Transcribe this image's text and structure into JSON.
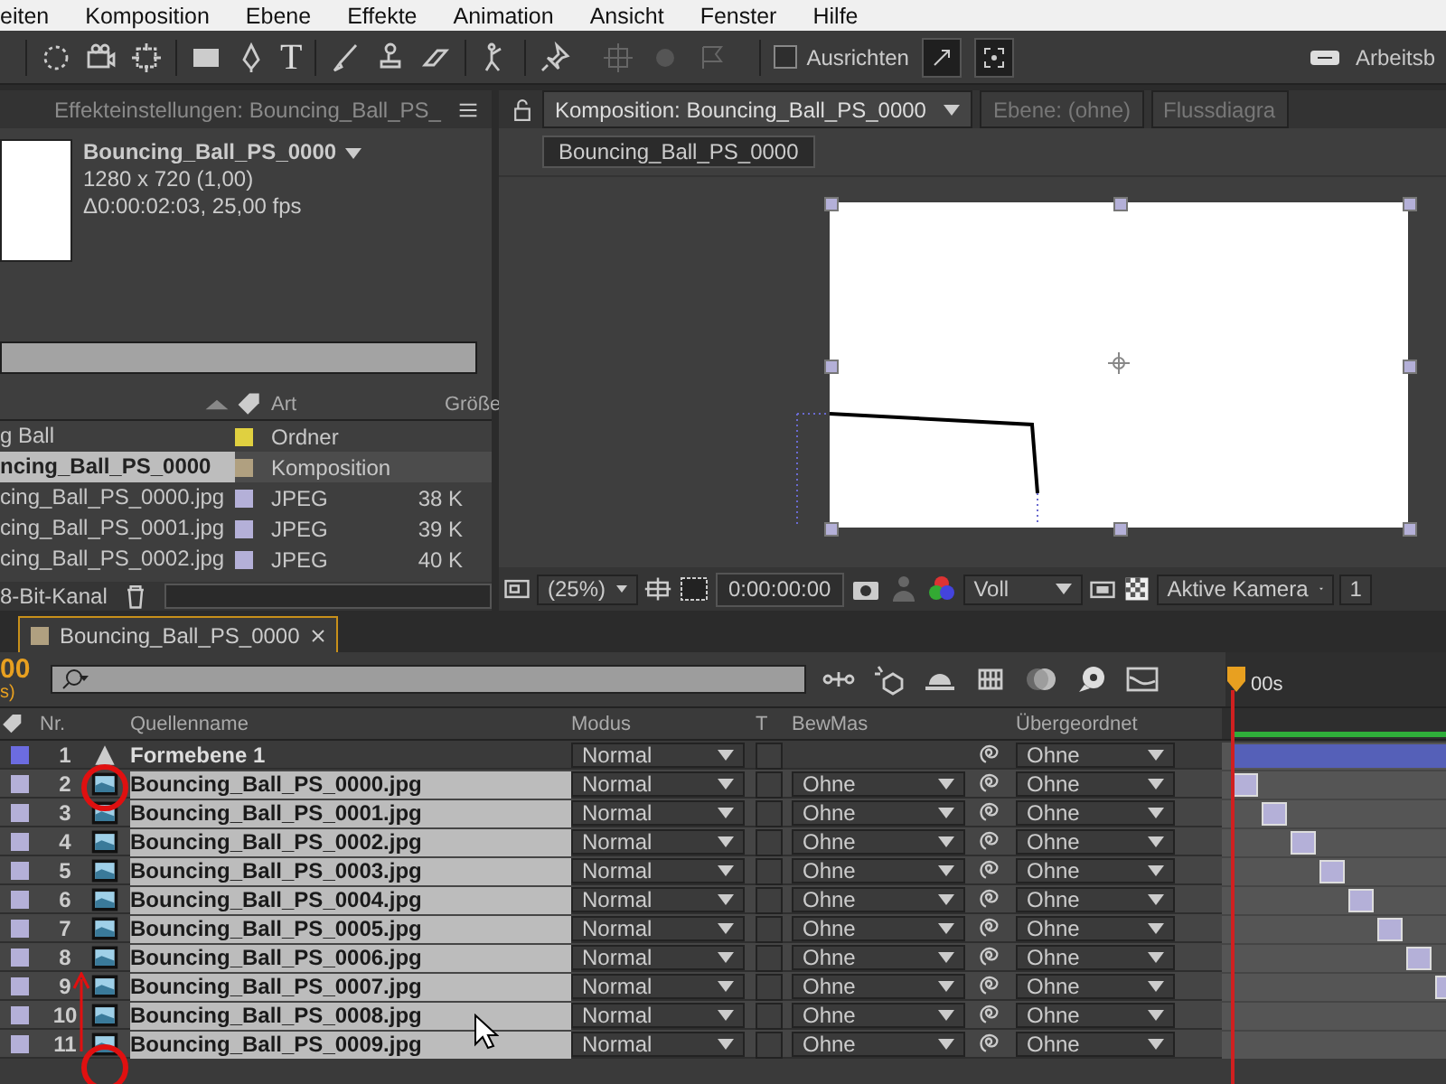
{
  "menu": [
    {
      "label": "eiten"
    },
    {
      "label": "Komposition"
    },
    {
      "label": "Ebene"
    },
    {
      "label": "Effekte"
    },
    {
      "label": "Animation"
    },
    {
      "label": "Ansicht"
    },
    {
      "label": "Fenster"
    },
    {
      "label": "Hilfe"
    }
  ],
  "toolbar": {
    "text_tool_glyph": "T",
    "align": {
      "label": "Ausrichten",
      "checked": false
    },
    "workspace_label": "Arbeitsb"
  },
  "project_panel": {
    "tab_title": "Effekteinstellungen: Bouncing_Ball_PS_",
    "comp_name": "Bouncing_Ball_PS_0000",
    "resolution": "1280 x 720 (1,00)",
    "duration": "Δ0:00:02:03, 25,00 fps",
    "columns": [
      "Art",
      "Größe"
    ],
    "items": [
      {
        "name": "g Ball",
        "type": "Ordner",
        "color": "#e0d040",
        "selected": false
      },
      {
        "name": "ncing_Ball_PS_0000",
        "type": "Komposition",
        "color": "#b0a080",
        "selected": true
      },
      {
        "name": "cing_Ball_PS_0000.jpg",
        "type": "JPEG",
        "size": "38 K",
        "color": "#b4b0d8",
        "selected": false
      },
      {
        "name": "cing_Ball_PS_0001.jpg",
        "type": "JPEG",
        "size": "39 K",
        "color": "#b4b0d8",
        "selected": false
      },
      {
        "name": "cing_Ball_PS_0002.jpg",
        "type": "JPEG",
        "size": "40 K",
        "color": "#b4b0d8",
        "selected": false
      }
    ],
    "footer": "8-Bit-Kanal"
  },
  "viewer": {
    "tabs": [
      {
        "label": "Komposition: Bouncing_Ball_PS_0000",
        "selected": true
      },
      {
        "label": "Ebene: (ohne)",
        "selected": false
      },
      {
        "label": "Flussdiagra",
        "selected": false
      }
    ],
    "breadcrumb": "Bouncing_Ball_PS_0000",
    "zoom": "(25%)",
    "timecode": "0:00:00:00",
    "resolution": "Voll",
    "camera": "Aktive Kamera",
    "extra": "1"
  },
  "timeline": {
    "tab_title": "Bouncing_Ball_PS_0000",
    "current_time": "00",
    "time_unit": "s)",
    "ruler_label": "00s",
    "columns": {
      "number": "Nr.",
      "name": "Quellenname",
      "mode": "Modus",
      "transparency": "T",
      "track_matte": "BewMas",
      "parent": "Übergeordnet"
    },
    "layers": [
      {
        "number": "1",
        "kind": "shape",
        "name": "Formebene 1",
        "mode": "Normal",
        "parent": "Ohne",
        "color": "#6c6ce0",
        "selected": false
      },
      {
        "number": "2",
        "kind": "footage",
        "name": "Bouncing_Ball_PS_0000.jpg",
        "mode": "Normal",
        "track_matte": "Ohne",
        "parent": "Ohne",
        "color": "#b4b0d8",
        "selected": true
      },
      {
        "number": "3",
        "kind": "footage",
        "name": "Bouncing_Ball_PS_0001.jpg",
        "mode": "Normal",
        "track_matte": "Ohne",
        "parent": "Ohne",
        "color": "#b4b0d8",
        "selected": true
      },
      {
        "number": "4",
        "kind": "footage",
        "name": "Bouncing_Ball_PS_0002.jpg",
        "mode": "Normal",
        "track_matte": "Ohne",
        "parent": "Ohne",
        "color": "#b4b0d8",
        "selected": true
      },
      {
        "number": "5",
        "kind": "footage",
        "name": "Bouncing_Ball_PS_0003.jpg",
        "mode": "Normal",
        "track_matte": "Ohne",
        "parent": "Ohne",
        "color": "#b4b0d8",
        "selected": true
      },
      {
        "number": "6",
        "kind": "footage",
        "name": "Bouncing_Ball_PS_0004.jpg",
        "mode": "Normal",
        "track_matte": "Ohne",
        "parent": "Ohne",
        "color": "#b4b0d8",
        "selected": true
      },
      {
        "number": "7",
        "kind": "footage",
        "name": "Bouncing_Ball_PS_0005.jpg",
        "mode": "Normal",
        "track_matte": "Ohne",
        "parent": "Ohne",
        "color": "#b4b0d8",
        "selected": true
      },
      {
        "number": "8",
        "kind": "footage",
        "name": "Bouncing_Ball_PS_0006.jpg",
        "mode": "Normal",
        "track_matte": "Ohne",
        "parent": "Ohne",
        "color": "#b4b0d8",
        "selected": true
      },
      {
        "number": "9",
        "kind": "footage",
        "name": "Bouncing_Ball_PS_0007.jpg",
        "mode": "Normal",
        "track_matte": "Ohne",
        "parent": "Ohne",
        "color": "#b4b0d8",
        "selected": true
      },
      {
        "number": "10",
        "kind": "footage",
        "name": "Bouncing_Ball_PS_0008.jpg",
        "mode": "Normal",
        "track_matte": "Ohne",
        "parent": "Ohne",
        "color": "#b4b0d8",
        "selected": true
      },
      {
        "number": "11",
        "kind": "footage",
        "name": "Bouncing_Ball_PS_0009.jpg",
        "mode": "Normal",
        "track_matte": "Ohne",
        "parent": "Ohne",
        "color": "#b4b0d8",
        "selected": true
      }
    ]
  }
}
